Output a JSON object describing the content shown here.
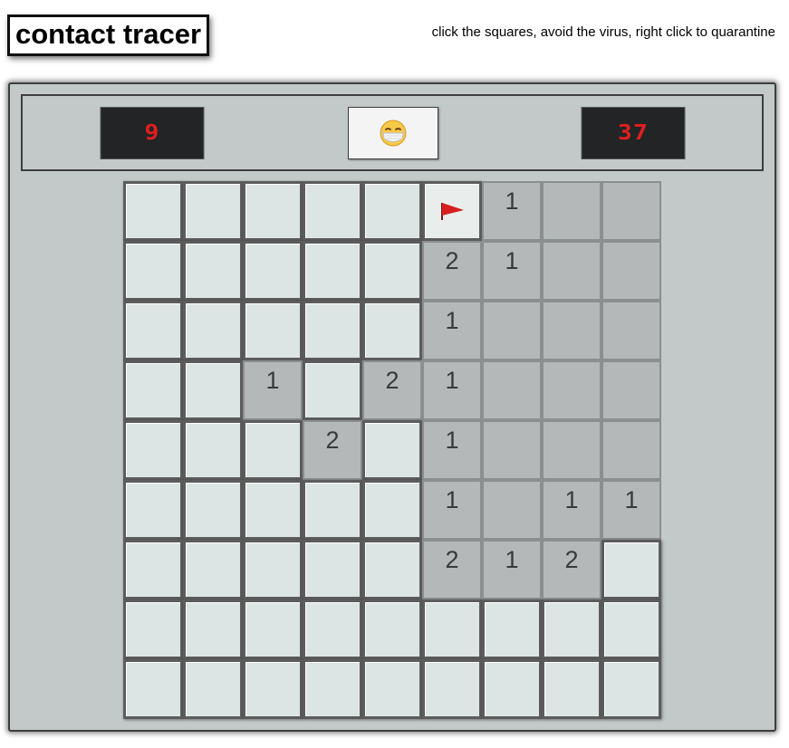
{
  "title": "contact tracer",
  "instructions": "click the squares, avoid the virus, right click to quarantine",
  "counters": {
    "flags_left": "9",
    "timer": "37"
  },
  "face_icon": "mask-face-icon",
  "colors": {
    "counter_text": "#e01f1f",
    "hidden_cell": "#dde5e4",
    "revealed_cell": "#b4b8b8",
    "panel_bg": "#c2c9c8"
  },
  "legend": "H = hidden, F = flagged/quarantined, R = revealed empty, 1/2 = revealed number, . = no cell",
  "board": [
    [
      "H",
      "H",
      "H",
      "H",
      "H",
      "F",
      "1",
      "R",
      "R"
    ],
    [
      "H",
      "H",
      "H",
      "H",
      "H",
      "2",
      "1",
      "R",
      "R"
    ],
    [
      "H",
      "H",
      "H",
      "H",
      "H",
      "1",
      "R",
      "R",
      "R"
    ],
    [
      "H",
      "H",
      "1",
      "H",
      "2",
      "1",
      "R",
      "R",
      "R"
    ],
    [
      "H",
      "H",
      "H",
      "2",
      "H",
      "1",
      "R",
      "R",
      "R"
    ],
    [
      "H",
      "H",
      "H",
      "H",
      "H",
      "1",
      "R",
      "1",
      "1"
    ],
    [
      "H",
      "H",
      "H",
      "H",
      "H",
      "2",
      "1",
      "2",
      "H"
    ],
    [
      "H",
      "H",
      "H",
      "H",
      "H",
      "H",
      "H",
      "H",
      "H"
    ],
    [
      "H",
      "H",
      "H",
      "H",
      "H",
      "H",
      "H",
      "H",
      "H"
    ]
  ]
}
